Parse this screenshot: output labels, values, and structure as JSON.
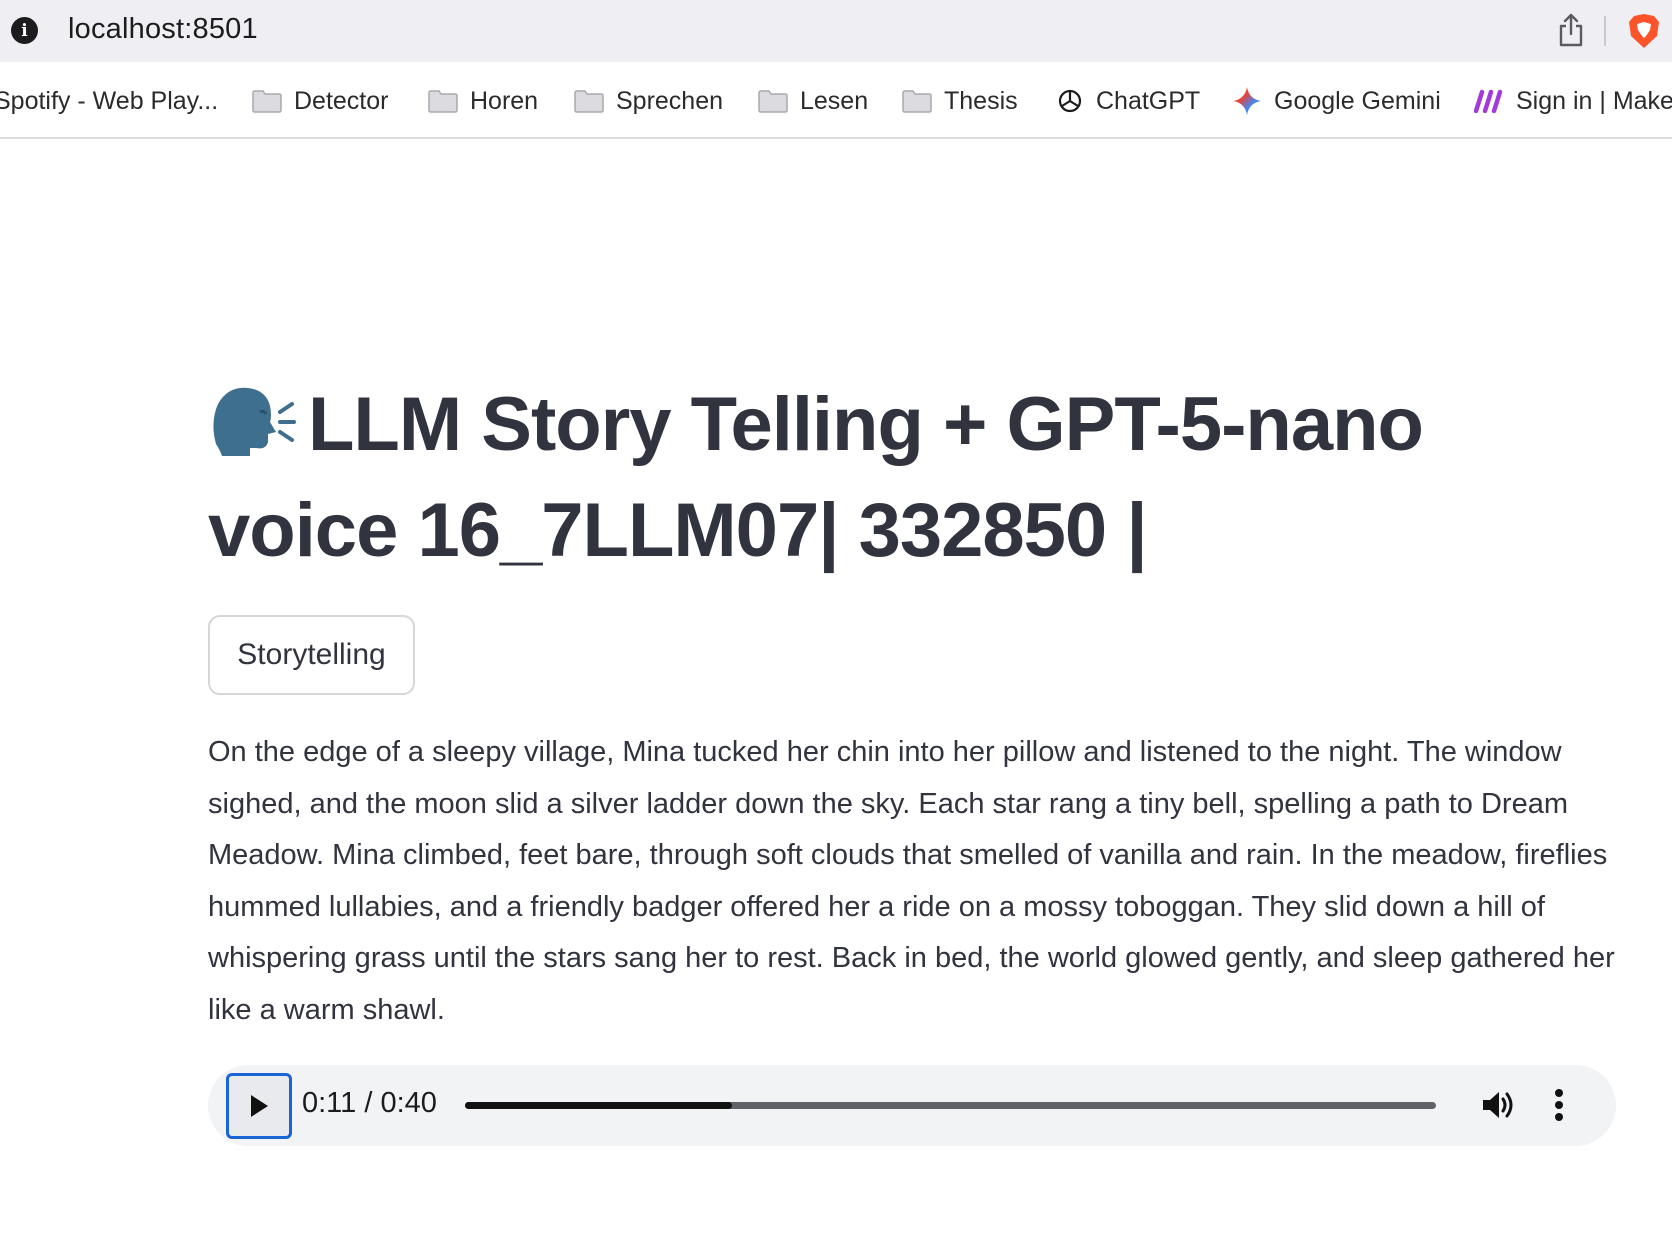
{
  "browser": {
    "url": "localhost:8501",
    "bookmarks": [
      {
        "label": "Spotify - Web Play...",
        "icon": "spotify-icon"
      },
      {
        "label": "Detector",
        "icon": "folder-icon"
      },
      {
        "label": "Horen",
        "icon": "folder-icon"
      },
      {
        "label": "Sprechen",
        "icon": "folder-icon"
      },
      {
        "label": "Lesen",
        "icon": "folder-icon"
      },
      {
        "label": "Thesis",
        "icon": "folder-icon"
      },
      {
        "label": "ChatGPT",
        "icon": "chatgpt-icon"
      },
      {
        "label": "Google Gemini",
        "icon": "gemini-icon"
      },
      {
        "label": "Sign in | Make",
        "icon": "make-icon"
      }
    ]
  },
  "app": {
    "title": "LLM Story Telling + GPT-5-nano voice 16_7LLM07| 332850 |",
    "title_icon": "speaking-head-icon",
    "tab_label": "Storytelling",
    "story": "On the edge of a sleepy village, Mina tucked her chin into her pillow and listened to the night. The window sighed, and the moon slid a silver ladder down the sky. Each star rang a tiny bell, spelling a path to Dream Meadow. Mina climbed, feet bare, through soft clouds that smelled of vanilla and rain. In the meadow, fireflies hummed lullabies, and a friendly badger offered her a ride on a mossy toboggan. They slid down a hill of whispering grass until the stars sang her to rest. Back in bed, the world glowed gently, and sleep gathered her like a warm shawl."
  },
  "player": {
    "time": "0:11 / 0:40",
    "progress": 0.275
  },
  "colors": {
    "text": "#31333f",
    "chrome_bg": "#efeff3",
    "player_bg": "#f1f3f4",
    "focus_ring": "#1a64d6"
  }
}
